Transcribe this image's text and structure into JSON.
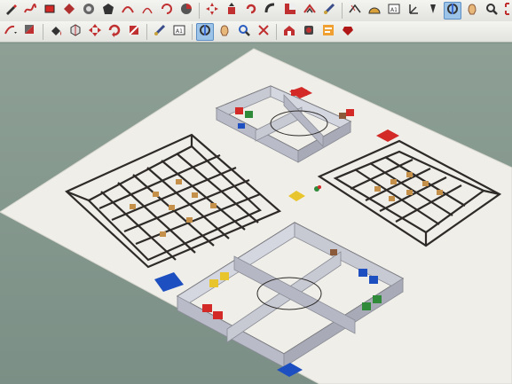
{
  "toolbar_top": {
    "tools": [
      {
        "name": "pencil-tool-icon"
      },
      {
        "name": "freehand-tool-icon"
      },
      {
        "name": "rectangle-tool-icon"
      },
      {
        "name": "rotated-rectangle-icon"
      },
      {
        "name": "circle-tool-icon"
      },
      {
        "name": "polygon-tool-icon"
      },
      {
        "name": "arc-tool-icon"
      },
      {
        "name": "two-point-arc-icon"
      },
      {
        "name": "three-point-arc-icon"
      },
      {
        "name": "pie-tool-icon"
      },
      {
        "name": "move-tool-icon"
      },
      {
        "name": "push-pull-icon"
      },
      {
        "name": "rotate-tool-icon"
      },
      {
        "name": "follow-me-icon"
      },
      {
        "name": "scale-tool-icon"
      },
      {
        "name": "offset-tool-icon"
      },
      {
        "name": "tape-measure-icon"
      },
      {
        "name": "dimension-tool-icon"
      },
      {
        "name": "protractor-icon"
      },
      {
        "name": "text-tool-icon"
      },
      {
        "name": "axes-tool-icon"
      },
      {
        "name": "3d-text-icon"
      },
      {
        "name": "orbit-tool-icon"
      },
      {
        "name": "pan-tool-icon"
      },
      {
        "name": "zoom-tool-icon"
      },
      {
        "name": "zoom-extents-icon"
      }
    ]
  },
  "toolbar_second": {
    "tools": [
      {
        "name": "line-dropdown-icon"
      },
      {
        "name": "material-dropdown-icon"
      },
      {
        "name": "paint-bucket-icon"
      },
      {
        "name": "component-icon"
      },
      {
        "name": "move-arrows-icon"
      },
      {
        "name": "rotate-arrows-icon"
      },
      {
        "name": "scale-box-icon"
      },
      {
        "name": "tape-measure-small-icon"
      },
      {
        "name": "text-label-icon"
      },
      {
        "name": "orbit-active-icon"
      },
      {
        "name": "hand-pan-icon"
      },
      {
        "name": "zoom-small-icon"
      },
      {
        "name": "zoom-extents-small-icon"
      },
      {
        "name": "warehouse-icon"
      },
      {
        "name": "extension-icon"
      },
      {
        "name": "layout-icon"
      },
      {
        "name": "ruby-icon"
      }
    ]
  },
  "board": {
    "colors": {
      "board": "#efeee8",
      "grid": "#2d2a28",
      "grid_node": "#c4904a",
      "wall_top": "#ffffff",
      "wall_side": "#c7c9d3",
      "red": "#d32a28",
      "blue": "#1d4fc0",
      "yellow": "#e9c52d",
      "green": "#2f8a3a",
      "brown": "#8a5a3a"
    },
    "markers": [
      "blue-marker",
      "red-marker-top",
      "red-marker-right",
      "yellow-center-marker",
      "blue-marker-bottom"
    ]
  }
}
